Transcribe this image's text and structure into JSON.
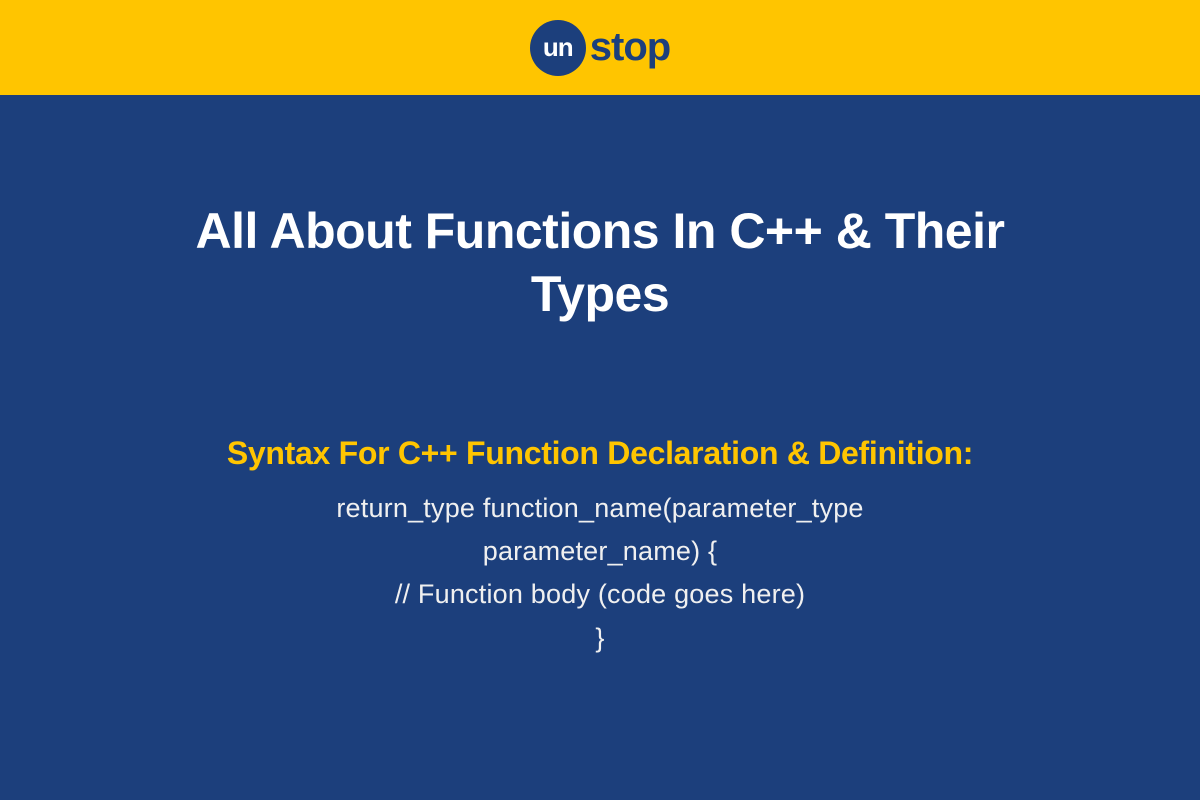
{
  "logo": {
    "circle_text": "un",
    "suffix_text": "stop"
  },
  "title": "All About Functions In C++ & Their Types",
  "syntax": {
    "heading": "Syntax For C++ Function Declaration & Definition:",
    "lines": [
      "return_type function_name(parameter_type",
      "parameter_name) {",
      "// Function body (code goes here)",
      "}"
    ]
  },
  "colors": {
    "header_bg": "#FFC500",
    "main_bg": "#1C3F7C",
    "title_text": "#FFFFFF",
    "heading_text": "#FFC500",
    "body_text": "#F0F0F0"
  }
}
